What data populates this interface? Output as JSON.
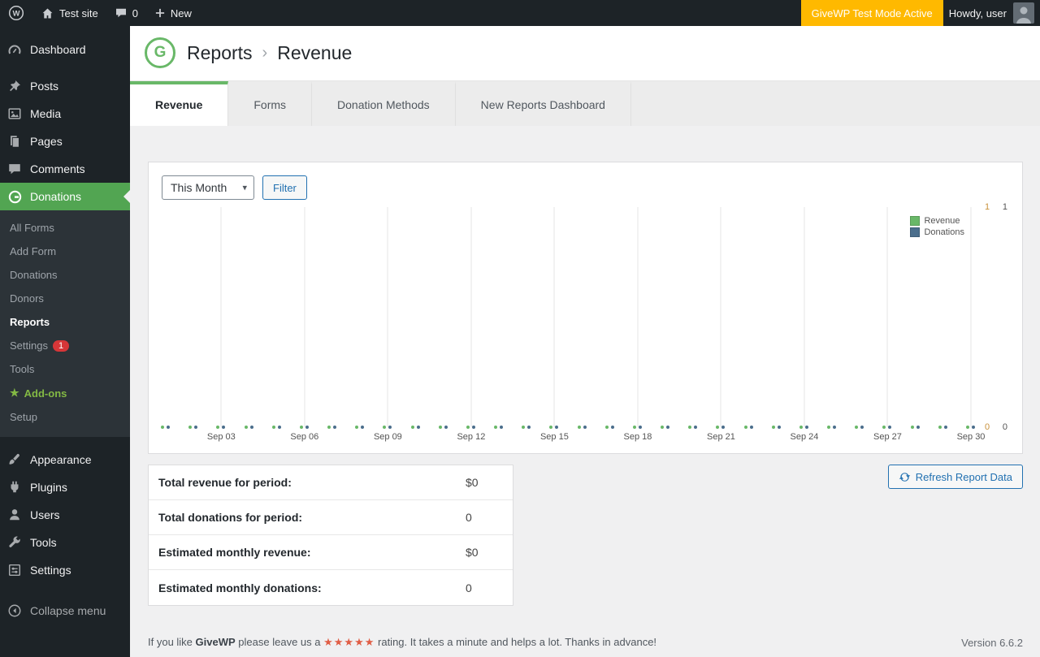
{
  "admin_bar": {
    "site_name": "Test site",
    "comments_count": "0",
    "new_label": "New",
    "test_mode_badge": "GiveWP Test Mode Active",
    "test_mode_bg": "#ffb900",
    "howdy_text": "Howdy, user"
  },
  "sidebar": {
    "items_top": [
      {
        "label": "Dashboard"
      },
      {
        "label": "Posts"
      },
      {
        "label": "Media"
      },
      {
        "label": "Pages"
      },
      {
        "label": "Comments"
      }
    ],
    "donations_item": {
      "label": "Donations"
    },
    "submenu": [
      {
        "label": "All Forms"
      },
      {
        "label": "Add Form"
      },
      {
        "label": "Donations"
      },
      {
        "label": "Donors"
      },
      {
        "label": "Reports",
        "current": true
      },
      {
        "label": "Settings",
        "badge": "1"
      },
      {
        "label": "Tools"
      },
      {
        "label": "Add-ons",
        "starred": true
      },
      {
        "label": "Setup"
      }
    ],
    "items_bottom": [
      {
        "label": "Appearance"
      },
      {
        "label": "Plugins"
      },
      {
        "label": "Users"
      },
      {
        "label": "Tools"
      },
      {
        "label": "Settings"
      }
    ],
    "collapse_label": "Collapse menu",
    "active_color": "#52a552",
    "addons_color": "#83b944"
  },
  "header": {
    "breadcrumb_root": "Reports",
    "breadcrumb_sep": "›",
    "breadcrumb_current": "Revenue"
  },
  "tabs": [
    {
      "label": "Revenue",
      "active": true
    },
    {
      "label": "Forms"
    },
    {
      "label": "Donation Methods"
    },
    {
      "label": "New Reports Dashboard"
    }
  ],
  "filter": {
    "period": "This Month",
    "button": "Filter"
  },
  "chart_data": {
    "type": "scatter",
    "title": "",
    "x": [
      "Sep 01",
      "Sep 02",
      "Sep 03",
      "Sep 04",
      "Sep 05",
      "Sep 06",
      "Sep 07",
      "Sep 08",
      "Sep 09",
      "Sep 10",
      "Sep 11",
      "Sep 12",
      "Sep 13",
      "Sep 14",
      "Sep 15",
      "Sep 16",
      "Sep 17",
      "Sep 18",
      "Sep 19",
      "Sep 20",
      "Sep 21",
      "Sep 22",
      "Sep 23",
      "Sep 24",
      "Sep 25",
      "Sep 26",
      "Sep 27",
      "Sep 28",
      "Sep 29",
      "Sep 30"
    ],
    "x_tick_labels": [
      "Sep 03",
      "Sep 06",
      "Sep 09",
      "Sep 12",
      "Sep 15",
      "Sep 18",
      "Sep 21",
      "Sep 24",
      "Sep 27",
      "Sep 30"
    ],
    "series": [
      {
        "name": "Revenue",
        "color": "#69b868",
        "values": [
          0,
          0,
          0,
          0,
          0,
          0,
          0,
          0,
          0,
          0,
          0,
          0,
          0,
          0,
          0,
          0,
          0,
          0,
          0,
          0,
          0,
          0,
          0,
          0,
          0,
          0,
          0,
          0,
          0,
          0
        ]
      },
      {
        "name": "Donations",
        "color": "#4b6e8c",
        "values": [
          0,
          0,
          0,
          0,
          0,
          0,
          0,
          0,
          0,
          0,
          0,
          0,
          0,
          0,
          0,
          0,
          0,
          0,
          0,
          0,
          0,
          0,
          0,
          0,
          0,
          0,
          0,
          0,
          0,
          0
        ]
      }
    ],
    "ylim": [
      0,
      1
    ],
    "y_axis": {
      "revenue_ticks": [
        "1",
        "0"
      ],
      "donations_ticks": [
        "1",
        "0"
      ],
      "revenue_tick_color": "#c9913b",
      "donations_tick_color": "#545454"
    },
    "legend_position": "top-right",
    "grid": true
  },
  "summary": {
    "rows": [
      {
        "label": "Total revenue for period:",
        "value": "$0"
      },
      {
        "label": "Total donations for period:",
        "value": "0"
      },
      {
        "label": "Estimated monthly revenue:",
        "value": "$0"
      },
      {
        "label": "Estimated monthly donations:",
        "value": "0"
      }
    ]
  },
  "refresh_button": {
    "label": "Refresh Report Data"
  },
  "footer": {
    "prefix": "If you like",
    "brand": "GiveWP",
    "middle": "please leave us a",
    "stars": "★★★★★",
    "suffix": "rating. It takes a minute and helps a lot. Thanks in advance!",
    "version": "Version 6.6.2"
  }
}
